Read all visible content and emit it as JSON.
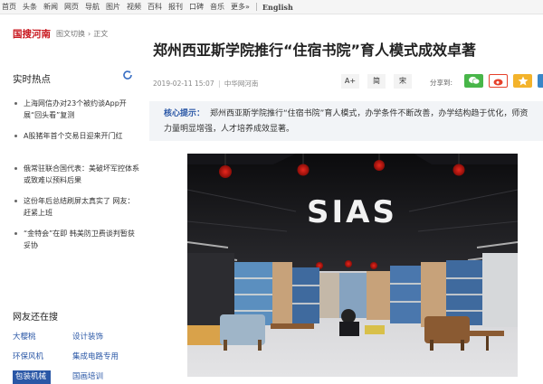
{
  "topnav": {
    "items": [
      "首页",
      "头条",
      "新闻",
      "网页",
      "导航",
      "图片",
      "视频",
      "百科",
      "报刊",
      "口碑",
      "音乐",
      "更多»"
    ],
    "english": "English"
  },
  "sidebar": {
    "logo": "国搜河南",
    "switch": "图文切换",
    "separator": "›",
    "body_text": "正文",
    "hot_title": "实时热点",
    "hot_items": [
      "上海网信办对23个被约谈App开展“回头看”复测",
      "A股猪年首个交易日迎来开门红",
      "俄常驻联合国代表：美破坏军控体系或致难以预料后果",
      "这份年后总结刷屏太真实了 网友：赶紧上班",
      "“金特会”在即 韩美防卫费谈判暂获妥协"
    ],
    "search_title": "网友还在搜",
    "search_tags": [
      "大樱桃",
      "设计装饰",
      "环保风机",
      "集成电路专用",
      "包装机械",
      "国画培训"
    ]
  },
  "article": {
    "headline": "郑州西亚斯学院推行“住宿书院”育人模式成效卓著",
    "date": "2019-02-11 15:07",
    "divider": "|",
    "source": "中华网河南",
    "font_buttons": [
      "A+",
      "简",
      "宋"
    ],
    "share_label": "分享到:",
    "summary_label": "核心提示：",
    "summary_text": "郑州西亚斯学院推行“住宿书院”育人模式，办学条件不断改善，办学结构趋于优化，师资力量明显增强，人才培养成效显著。",
    "photo_sign": "SIAS"
  },
  "colors": {
    "brand_red": "#c8161d",
    "link_blue": "#2a57a6",
    "wechat": "#48b649",
    "weibo": "#e6412b",
    "qzone": "#f3b32b",
    "other": "#3a86c8"
  },
  "icons": {
    "refresh": "refresh-icon",
    "share": [
      "wechat-icon",
      "weibo-icon",
      "qzone-icon",
      "share-more-icon"
    ]
  }
}
